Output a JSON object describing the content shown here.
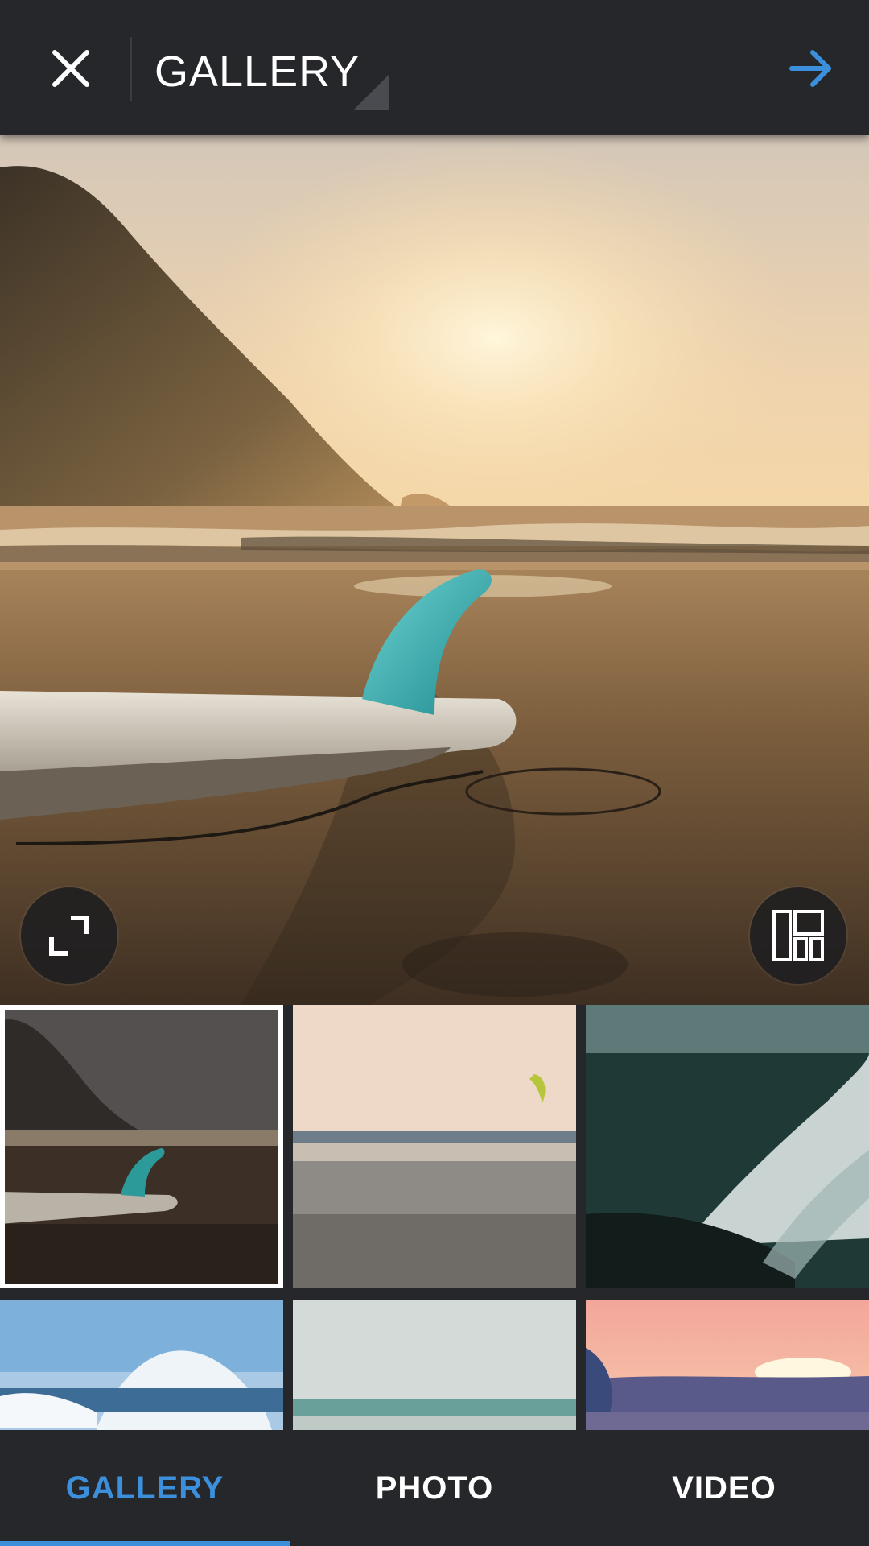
{
  "header": {
    "title": "GALLERY",
    "close_icon": "close-icon",
    "next_icon": "arrow-right-icon",
    "accent_color": "#3c8fdb"
  },
  "preview": {
    "subject": "surfboard on beach at sunset",
    "expand_icon": "expand-icon",
    "layout_icon": "layout-icon"
  },
  "thumbnails": [
    {
      "subject": "surfboard on beach at sunset",
      "selected": true
    },
    {
      "subject": "kite surfer over sea"
    },
    {
      "subject": "ocean wave aerial"
    },
    {
      "subject": "wave splash"
    },
    {
      "subject": "misty sea"
    },
    {
      "subject": "sunset over clouds"
    }
  ],
  "tabs": [
    {
      "label": "GALLERY",
      "active": true
    },
    {
      "label": "PHOTO",
      "active": false
    },
    {
      "label": "VIDEO",
      "active": false
    }
  ],
  "colors": {
    "bar_background": "#26272b",
    "active_tab": "#3c8fdb",
    "inactive_tab": "#ffffff"
  }
}
